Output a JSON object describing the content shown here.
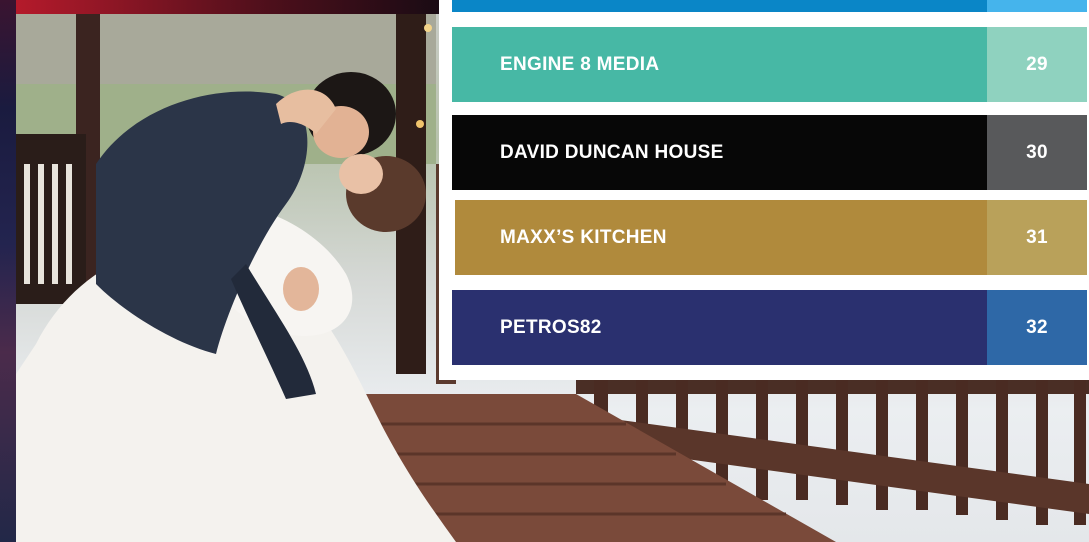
{
  "colors": {
    "row0_main": "#0a86c7",
    "row0_num": "#45b4ec",
    "row1_main": "#47b8a5",
    "row1_num": "#8fd2bf",
    "row2_main": "#070707",
    "row2_num": "#58595b",
    "row3_main": "#b08a3c",
    "row3_num": "#b9a15a",
    "row4_main": "#2a306f",
    "row4_num": "#2e68a7"
  },
  "directory": [
    {
      "name": "ENGINE 8 MEDIA",
      "page": "29"
    },
    {
      "name": "DAVID DUNCAN HOUSE",
      "page": "30"
    },
    {
      "name": "MAXX’S KITCHEN",
      "page": "31"
    },
    {
      "name": "PETROS82",
      "page": "32"
    }
  ]
}
